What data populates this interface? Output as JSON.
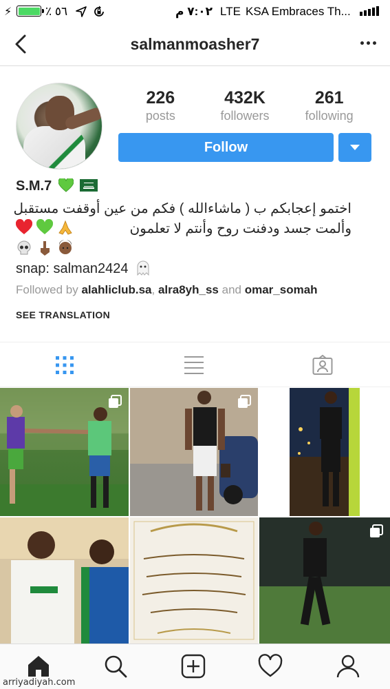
{
  "status_bar": {
    "battery_text": "٪ ٥٦",
    "time": "٧:٠٢ م",
    "network": "LTE",
    "carrier": "KSA Embraces Th..."
  },
  "nav": {
    "username": "salmanmoasher7"
  },
  "stats": [
    {
      "value": "226",
      "label": "posts"
    },
    {
      "value": "432K",
      "label": "followers"
    },
    {
      "value": "261",
      "label": "following"
    }
  ],
  "actions": {
    "follow_label": "Follow"
  },
  "bio": {
    "name": "S.M.7",
    "line1": "اختمو إعجابكم ب ( ماشاءالله ) فكم من عين أوقفت مستقبل",
    "line2": "وألمت جسد ودفنت روح وأنتم لا تعلمون",
    "snap": "snap: salman2424",
    "followed_prefix": "Followed by",
    "followed_user1": "alahliclub.sa",
    "followed_sep": ",",
    "followed_user2": "alra8yh_ss",
    "followed_and": "and",
    "followed_user3": "omar_somah",
    "see_translation": "SEE TRANSLATION"
  },
  "icons": {
    "back": "chevron-left-icon",
    "more": "more-horizontal-icon",
    "grid_view": "grid-icon",
    "list_view": "list-icon",
    "tagged": "tagged-photos-icon",
    "home": "home-icon",
    "search": "search-icon",
    "add": "add-post-icon",
    "activity": "heart-icon",
    "profile": "profile-icon"
  },
  "colors": {
    "follow_button": "#3897f0",
    "active_tab": "#3897f0",
    "secondary_text": "#999999"
  },
  "watermark": "arriyadiyah.com"
}
